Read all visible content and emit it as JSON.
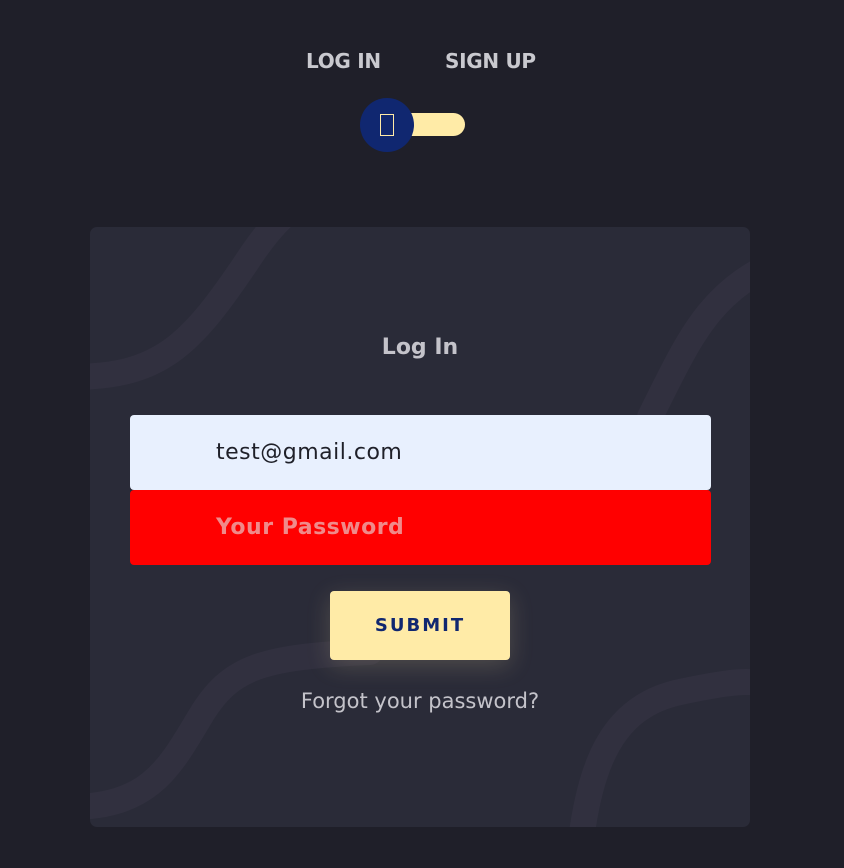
{
  "toggle": {
    "login_label": "LOG IN",
    "signup_label": "SIGN UP",
    "state": "login",
    "knob_icon": "box-icon",
    "knob_color": "#102770",
    "track_color": "#ffeba7"
  },
  "form": {
    "title": "Log In",
    "email_value": "test@gmail.com",
    "password_placeholder": "Your Password",
    "password_value": "",
    "submit_label": "SUBMIT",
    "forgot_label": "Forgot your password?"
  },
  "colors": {
    "background": "#1f1f29",
    "card": "#2a2b38",
    "accent": "#ffeba7",
    "brand": "#102770",
    "error": "#ff0000",
    "email_fill": "#e8f0fe"
  }
}
